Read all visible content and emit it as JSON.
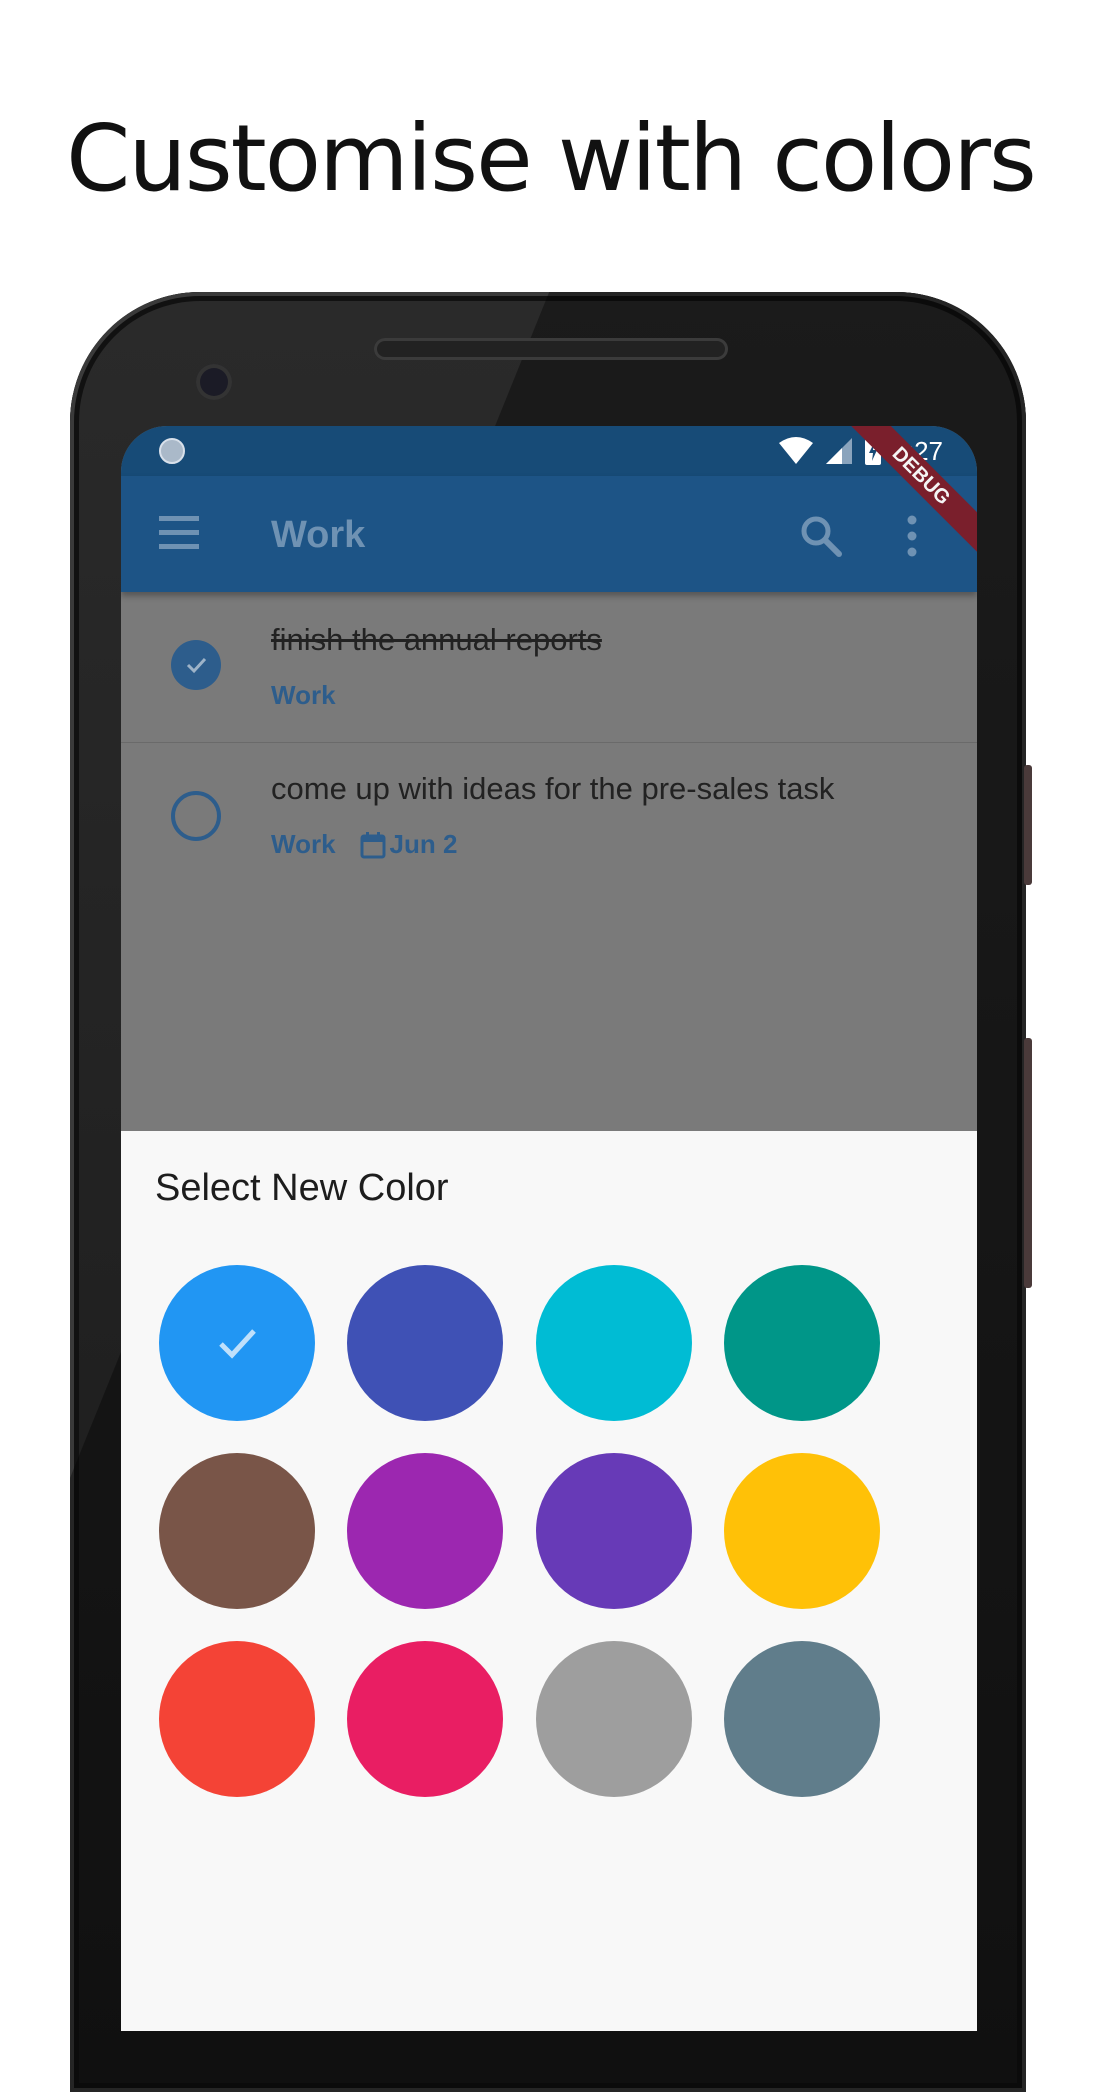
{
  "headline": "Customise with colors",
  "status_bar": {
    "time": "4:27"
  },
  "debug_label": "DEBUG",
  "app_bar": {
    "title": "Work",
    "menu_icon": "menu-icon",
    "search_icon": "search-icon",
    "more_icon": "more-vert-icon"
  },
  "tasks": [
    {
      "title": "finish the annual reports",
      "completed": true,
      "list": "Work",
      "due": ""
    },
    {
      "title": "come up with ideas for the pre-sales task",
      "completed": false,
      "list": "Work",
      "due": "Jun 2"
    }
  ],
  "color_sheet": {
    "title": "Select New Color",
    "selected": "blue",
    "colors": [
      {
        "name": "blue",
        "hex": "#2196f3"
      },
      {
        "name": "indigo",
        "hex": "#3f51b5"
      },
      {
        "name": "cyan",
        "hex": "#00bcd4"
      },
      {
        "name": "teal",
        "hex": "#009688"
      },
      {
        "name": "brown",
        "hex": "#795548"
      },
      {
        "name": "purple",
        "hex": "#9c27b0"
      },
      {
        "name": "deep-purple",
        "hex": "#673ab7"
      },
      {
        "name": "amber",
        "hex": "#ffc107"
      },
      {
        "name": "red",
        "hex": "#f44336"
      },
      {
        "name": "pink",
        "hex": "#e91e63"
      },
      {
        "name": "grey",
        "hex": "#9e9e9e"
      },
      {
        "name": "blue-grey",
        "hex": "#607d8b"
      }
    ]
  },
  "accent": "#2d5d8c"
}
